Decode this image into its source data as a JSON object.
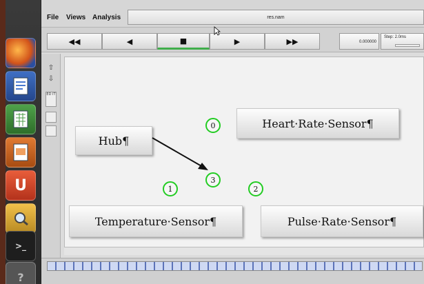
{
  "menu": {
    "file": "File",
    "views": "Views",
    "analysis": "Analysis"
  },
  "filename": "res.nam",
  "playback": {
    "rewind_fast": "◀◀",
    "rewind": "◀",
    "stop": "■",
    "play": "▶",
    "forward_fast": "▶▶"
  },
  "time": "0.000000",
  "step_label": "Step: 2.0ms",
  "sidetools": [
    "⇧",
    "⇩",
    "ED IT"
  ],
  "nodes": {
    "hub": "Hub¶",
    "heart": "Heart·Rate·Sensor¶",
    "temperature": "Temperature·Sensor¶",
    "pulse": "Pulse·Rate·Sensor¶"
  },
  "circles": [
    "0",
    "1",
    "2",
    "3"
  ],
  "colors": {
    "circle_border": "#22cc22",
    "progress": "#3fae4a",
    "timeline_tick": "#5c73b8"
  },
  "launcher_icons": [
    "firefox-icon",
    "writer-icon",
    "calc-icon",
    "impress-icon",
    "ubuntu-one-icon",
    "screenshot-icon",
    "terminal-icon",
    "help-icon"
  ]
}
